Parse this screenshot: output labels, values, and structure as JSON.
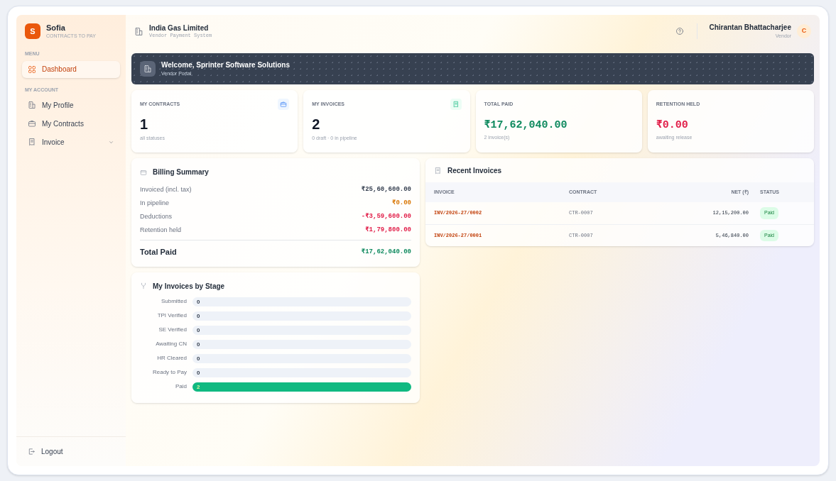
{
  "brand": {
    "logo_letter": "S",
    "name": "Sofia",
    "tagline": "CONTRACTS TO PAY"
  },
  "sidebar": {
    "sections": [
      {
        "heading": "MENU",
        "items": [
          {
            "label": "Dashboard",
            "selected": true,
            "expandable": false
          }
        ]
      },
      {
        "heading": "MY ACCOUNT",
        "items": [
          {
            "label": "My Profile",
            "selected": false,
            "expandable": false
          },
          {
            "label": "My Contracts",
            "selected": false,
            "expandable": false
          },
          {
            "label": "Invoice",
            "selected": false,
            "expandable": true
          }
        ]
      }
    ],
    "logout": "Logout"
  },
  "header": {
    "company": "India Gas Limited",
    "subtitle": "Vendor Payment System",
    "user": {
      "name": "Chirantan Bhattacharjee",
      "role": "Vendor",
      "initial": "C"
    }
  },
  "welcome": {
    "title": "Welcome, Sprinter Software Solutions",
    "subtitle": "Vendor Portal"
  },
  "stats": [
    {
      "label": "MY CONTRACTS",
      "value": "1",
      "note": "all statuses",
      "kind": "count",
      "color": "#111827"
    },
    {
      "label": "MY INVOICES",
      "value": "2",
      "note": "0 draft · 0 in pipeline",
      "kind": "count",
      "color": "#111827"
    },
    {
      "label": "TOTAL PAID",
      "value": "₹17,62,040.00",
      "note": "2 invoice(s)",
      "kind": "amount",
      "color": "#0f8a5f"
    },
    {
      "label": "RETENTION HELD",
      "value": "₹0.00",
      "note": "awaiting release",
      "kind": "amount",
      "color": "#e11d48"
    }
  ],
  "billing_summary": {
    "title": "Billing Summary",
    "rows": [
      {
        "label": "Invoiced (incl. tax)",
        "value": "₹25,60,600.00",
        "color": "#374151"
      },
      {
        "label": "In pipeline",
        "value": "₹0.00",
        "color": "#d97706"
      },
      {
        "label": "Deductions",
        "value": "-₹3,59,600.00",
        "color": "#e11d48"
      },
      {
        "label": "Retention held",
        "value": "₹1,79,800.00",
        "color": "#e11d48"
      }
    ],
    "total": {
      "label": "Total Paid",
      "value": "₹17,62,040.00"
    }
  },
  "stages": {
    "title": "My Invoices by Stage",
    "items": [
      {
        "label": "Submitted",
        "count": "0",
        "level": 0
      },
      {
        "label": "TPI Verified",
        "count": "0",
        "level": 0
      },
      {
        "label": "SE Verified",
        "count": "0",
        "level": 0
      },
      {
        "label": "Awaiting CN",
        "count": "0",
        "level": 0
      },
      {
        "label": "HR Cleared",
        "count": "0",
        "level": 0
      },
      {
        "label": "Ready to Pay",
        "count": "0",
        "level": 0
      },
      {
        "label": "Paid",
        "count": "2",
        "level": 1
      }
    ]
  },
  "recent_invoices": {
    "title": "Recent Invoices",
    "columns": [
      "INVOICE",
      "CONTRACT",
      "NET (₹)",
      "STATUS"
    ],
    "rows": [
      {
        "invoice": "INV/2026-27/0002",
        "contract": "CTR-0007",
        "net": "12,15,200.00",
        "status": "Paid"
      },
      {
        "invoice": "INV/2026-27/0001",
        "contract": "CTR-0007",
        "net": "5,46,840.00",
        "status": "Paid"
      }
    ]
  }
}
